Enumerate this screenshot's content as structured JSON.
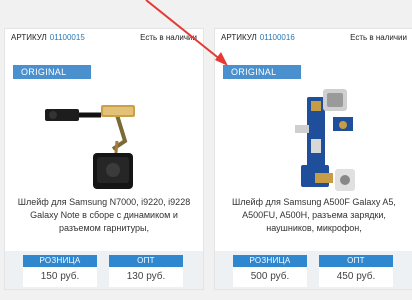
{
  "products": [
    {
      "sku_label": "АРТИКУЛ",
      "sku": "01100015",
      "stock": "Есть в наличии",
      "badge": "ORIGINAL",
      "description": "Шлейф для Samsung N7000, i9220, i9228 Galaxy Note в сборе с динамиком и разъемом гарнитуры,",
      "retail_label": "РОЗНИЦА",
      "retail_price": "150 руб.",
      "wholesale_label": "ОПТ",
      "wholesale_price": "130 руб."
    },
    {
      "sku_label": "АРТИКУЛ",
      "sku": "01100016",
      "stock": "Есть в наличии",
      "badge": "ORIGINAL",
      "description": "Шлейф для Samsung A500F Galaxy A5, A500FU, A500H, разъема зарядки, наушников, микрофон,",
      "retail_label": "РОЗНИЦА",
      "retail_price": "500 руб.",
      "wholesale_label": "ОПТ",
      "wholesale_price": "450 руб."
    }
  ],
  "colors": {
    "accent": "#2f87cf",
    "badge": "#4a90cf",
    "sku": "#2a79b8",
    "annotation_arrow": "#e53935"
  }
}
